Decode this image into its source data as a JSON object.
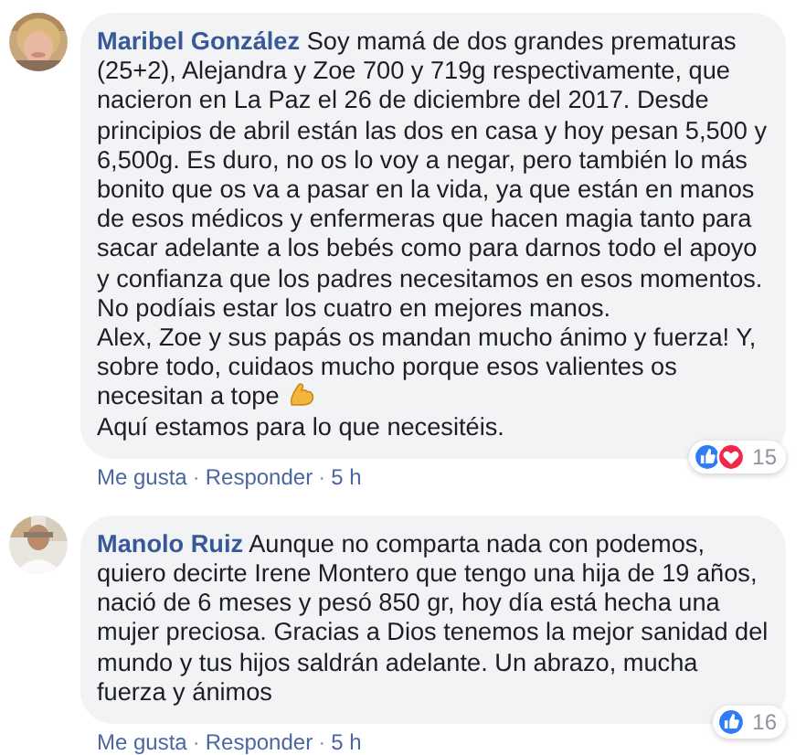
{
  "comments": [
    {
      "author": "Maribel González",
      "paragraphs": [
        {
          "text": "Soy mamá de dos grandes prematuras (25+2), Alejandra y Zoe 700 y 719g respectivamente, que nacieron en La Paz el 26 de diciembre del 2017. Desde principios de abril están las dos en casa y hoy pesan 5,500 y 6,500g. Es duro, no os lo voy a negar, pero también lo más bonito que os va a pasar en la vida, ya que están en manos de esos médicos y enfermeras que hacen magia tanto para sacar adelante a los bebés como para darnos todo el apoyo y confianza que los padres necesitamos en esos momentos.",
          "emoji_after": false
        },
        {
          "text": "No podíais estar los cuatro en mejores manos.",
          "emoji_after": false
        },
        {
          "text": "Alex, Zoe y sus papás os mandan mucho ánimo y fuerza! Y, sobre todo, cuidaos mucho porque esos valientes os necesitan a tope",
          "emoji_after": true
        },
        {
          "text": "Aquí estamos para lo que necesitéis.",
          "emoji_after": false
        }
      ],
      "reactions": [
        {
          "kind": "like"
        },
        {
          "kind": "love"
        }
      ],
      "reaction_count": "15",
      "actions": [
        "Me gusta",
        "Responder"
      ],
      "separator": "·",
      "time": "5 h"
    },
    {
      "author": "Manolo Ruiz",
      "paragraphs": [
        {
          "text": "Aunque no comparta nada con podemos, quiero decirte Irene Montero que tengo una hija de 19 años, nació de 6 meses y pesó 850 gr, hoy día está hecha una mujer preciosa. Gracias a Dios tenemos la mejor sanidad del mundo y tus hijos saldrán adelante. Un abrazo, mucha fuerza y ánimos",
          "emoji_after": false
        }
      ],
      "reactions": [
        {
          "kind": "like"
        }
      ],
      "reaction_count": "16",
      "actions": [
        "Me gusta",
        "Responder"
      ],
      "separator": "·",
      "time": "5 h"
    }
  ]
}
